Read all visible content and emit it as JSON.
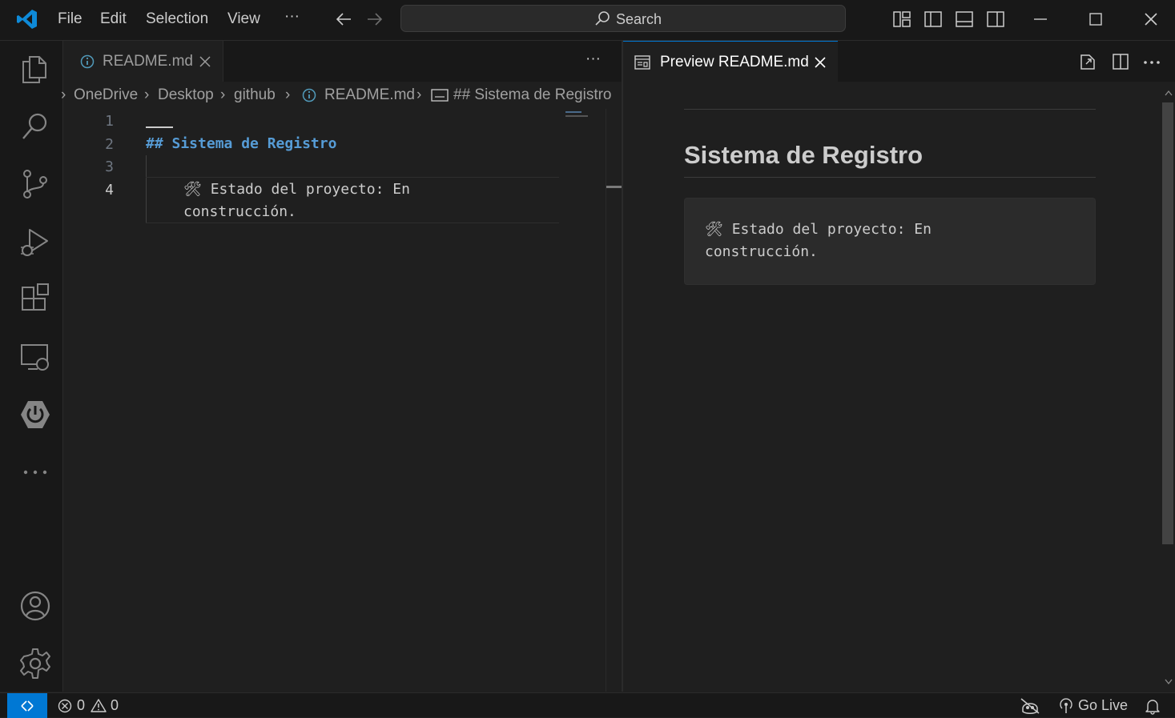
{
  "menu": {
    "file": "File",
    "edit": "Edit",
    "selection": "Selection",
    "view": "View",
    "more": "···"
  },
  "search": {
    "label": "Search"
  },
  "editor": {
    "tab_label": "README.md",
    "more": "···",
    "breadcrumb": {
      "c1": "OneDrive",
      "c2": "Desktop",
      "c3": "github",
      "c4": "README.md",
      "c5": "## Sistema de Registro"
    },
    "line_numbers": [
      "1",
      "2",
      "3",
      "4"
    ],
    "lines": {
      "l2": "## Sistema de Registro",
      "l4a": "🛠 Estado del proyecto: En",
      "l4b": "construcción."
    }
  },
  "preview": {
    "tab_label": "Preview README.md",
    "heading": "Sistema de Registro",
    "code_line1": "🛠 Estado del proyecto: En",
    "code_line2": "construcción."
  },
  "status": {
    "errors": "0",
    "warnings": "0",
    "go_live": "Go Live"
  },
  "colors": {
    "accent": "#0078d4",
    "heading_blue": "#569cd6",
    "background": "#1f1f1f"
  }
}
